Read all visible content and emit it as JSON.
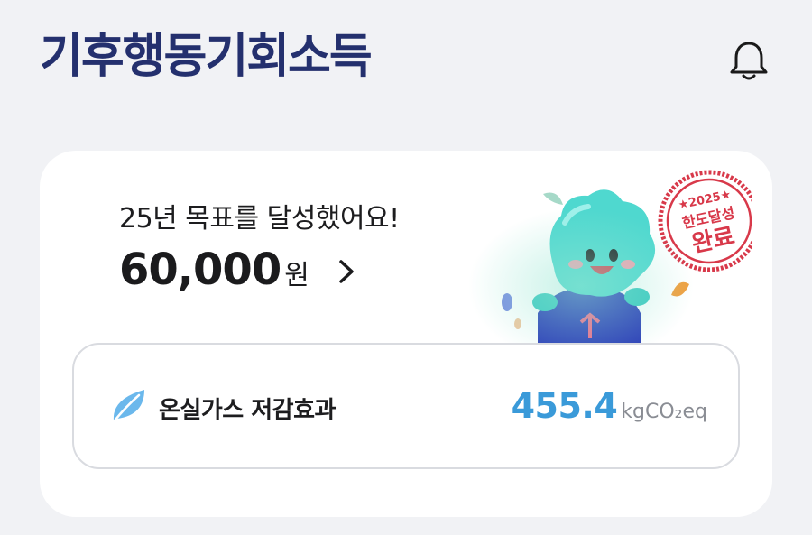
{
  "header": {
    "logo_text": "기후행동기회소득",
    "bell_icon": "bell-icon"
  },
  "card": {
    "goal_text": "25년 목표를 달성했어요!",
    "amount": "60,000",
    "amount_unit": "원",
    "stamp": {
      "year_line": "★2025★",
      "line1": "한도달성",
      "line2": "완료"
    }
  },
  "effect": {
    "label": "온실가스 저감효과",
    "value": "455.4",
    "unit": "kgCO₂eq",
    "icon": "leaf-icon"
  },
  "colors": {
    "brand_navy": "#24306e",
    "accent_blue": "#3a9ad9",
    "stamp_red": "#d8394a",
    "background": "#f1f2f5"
  }
}
